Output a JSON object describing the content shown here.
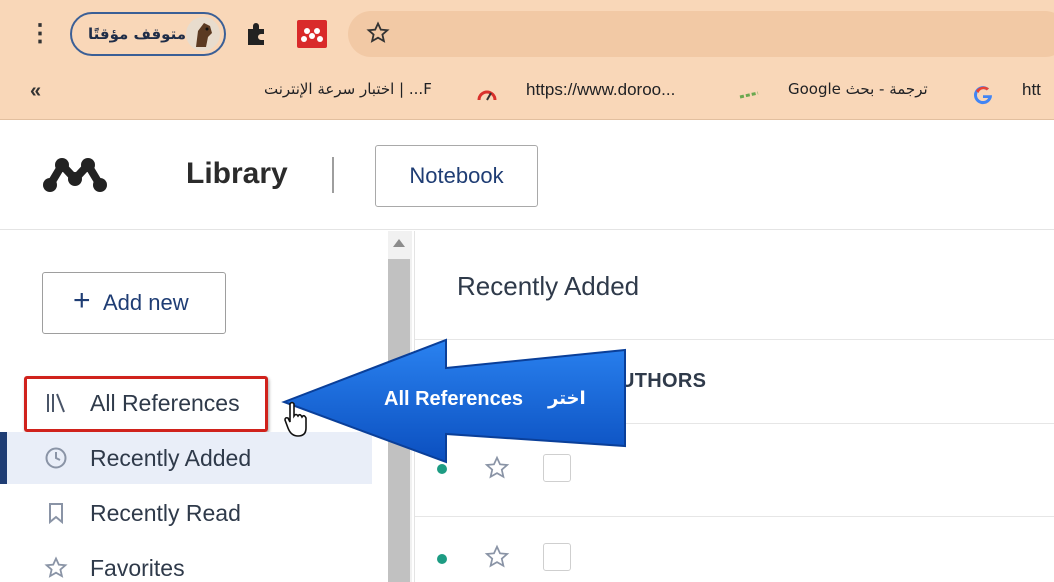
{
  "browser": {
    "profile_label": "متوقف مؤقتًا",
    "bookmarks": [
      {
        "label": "F... | اختبار سرعة الإنترنت"
      },
      {
        "label": "https://www.doroo..."
      },
      {
        "label": "ترجمة - بحث Google"
      },
      {
        "label": "htt"
      }
    ]
  },
  "app": {
    "title": "Library",
    "notebook_label": "Notebook"
  },
  "sidebar": {
    "add_label": "Add new",
    "items": [
      {
        "label": "All References",
        "icon": "library-icon"
      },
      {
        "label": "Recently Added",
        "icon": "clock-icon"
      },
      {
        "label": "Recently Read",
        "icon": "bookmark-icon"
      },
      {
        "label": "Favorites",
        "icon": "star-icon"
      }
    ]
  },
  "main": {
    "title": "Recently Added",
    "authors_col": "UTHORS"
  },
  "callout": {
    "text": "All References",
    "arabic": "اختر"
  },
  "colors": {
    "chrome": "#f9d7b8",
    "accent": "#1f3d74",
    "highlight": "#d0221c",
    "callout": "#1565d8",
    "status_dot": "#1d9c83"
  }
}
